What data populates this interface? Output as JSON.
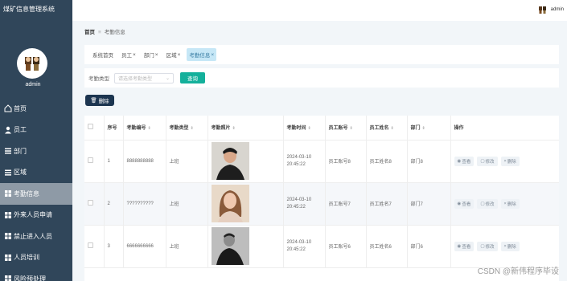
{
  "app": {
    "title": "煤矿信息管理系统",
    "user": "admin"
  },
  "sidebar": {
    "admin_name": "admin",
    "items": [
      {
        "label": "首页",
        "icon": "home-icon"
      },
      {
        "label": "员工",
        "icon": "user-icon"
      },
      {
        "label": "部门",
        "icon": "list-icon"
      },
      {
        "label": "区域",
        "icon": "list-icon"
      },
      {
        "label": "考勤信息",
        "icon": "grid-icon",
        "active": true
      },
      {
        "label": "外来人员申请",
        "icon": "grid-icon"
      },
      {
        "label": "禁止进入人员",
        "icon": "grid-icon"
      },
      {
        "label": "人员培训",
        "icon": "grid-icon"
      },
      {
        "label": "风险预处理",
        "icon": "grid-icon"
      }
    ]
  },
  "breadcrumb": {
    "home": "首页",
    "current": "考勤信息"
  },
  "tabs": [
    {
      "label": "系统首页",
      "closable": false
    },
    {
      "label": "员工",
      "closable": true
    },
    {
      "label": "部门",
      "closable": true
    },
    {
      "label": "区域",
      "closable": true
    },
    {
      "label": "考勤信息",
      "closable": true,
      "active": true
    }
  ],
  "search": {
    "label": "考勤类型",
    "placeholder": "请选择考勤类型",
    "button": "查询"
  },
  "toolbar": {
    "delete_label": "删除"
  },
  "table": {
    "columns": [
      "序号",
      "考勤编号",
      "考勤类型",
      "考勤照片",
      "考勤时间",
      "员工账号",
      "员工姓名",
      "部门",
      "操作"
    ],
    "rows": [
      {
        "index": "1",
        "code": "8888888888",
        "type": "上班",
        "time": "2024-03-10 20:45:22",
        "account": "员工账号8",
        "name": "员工姓名8",
        "dept": "部门8"
      },
      {
        "index": "2",
        "code": "??????????",
        "type": "上班",
        "time": "2024-03-10 20:45:22",
        "account": "员工账号7",
        "name": "员工姓名7",
        "dept": "部门7"
      },
      {
        "index": "3",
        "code": "6666666666",
        "type": "上班",
        "time": "2024-03-10 20:45:22",
        "account": "员工账号6",
        "name": "员工姓名6",
        "dept": "部门6"
      }
    ],
    "actions": {
      "view": "查看",
      "edit": "修改",
      "delete": "删除"
    }
  },
  "watermark": "CSDN @新伟程序毕设"
}
